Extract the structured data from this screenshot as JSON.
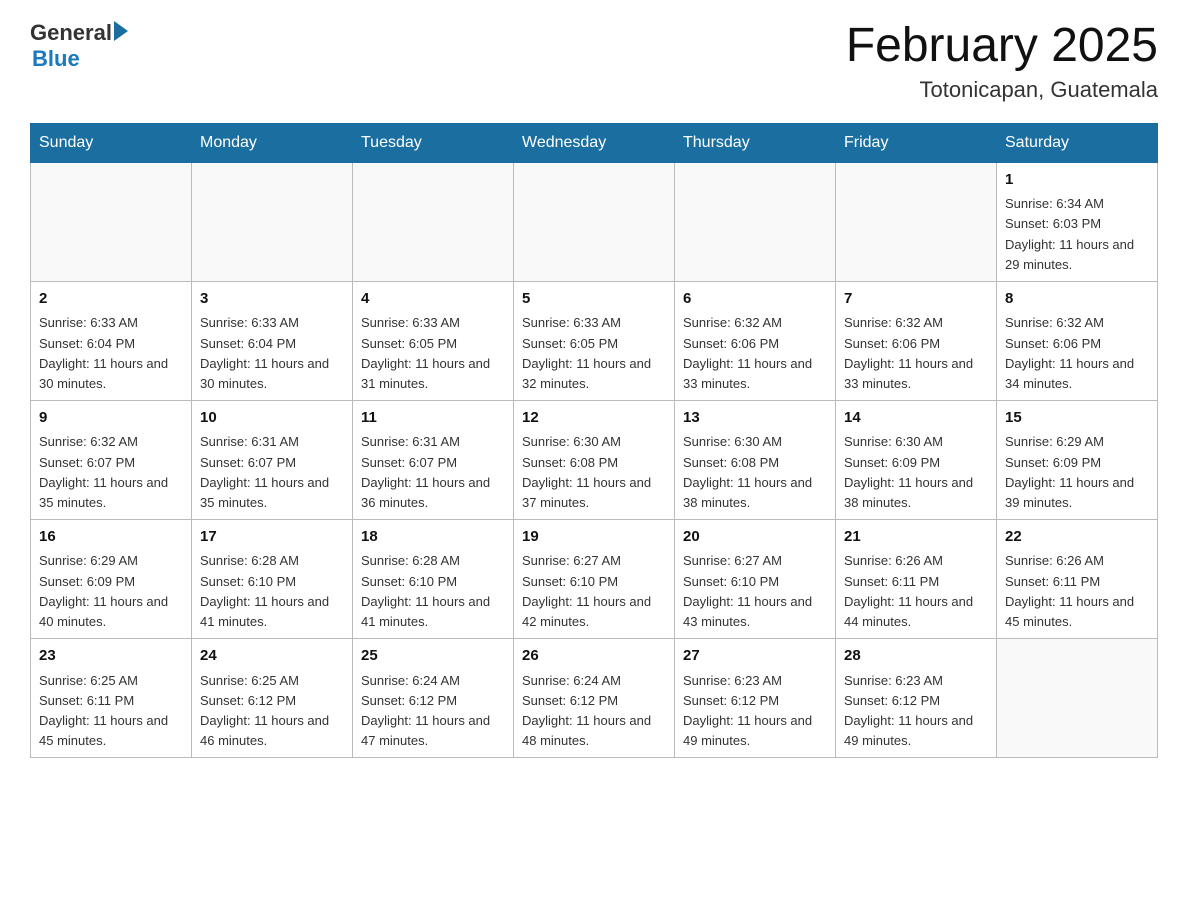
{
  "header": {
    "logo": {
      "line1": "General",
      "arrow": true,
      "line2": "Blue"
    },
    "title": "February 2025",
    "subtitle": "Totonicapan, Guatemala"
  },
  "days_of_week": [
    "Sunday",
    "Monday",
    "Tuesday",
    "Wednesday",
    "Thursday",
    "Friday",
    "Saturday"
  ],
  "weeks": [
    [
      {
        "day": "",
        "info": ""
      },
      {
        "day": "",
        "info": ""
      },
      {
        "day": "",
        "info": ""
      },
      {
        "day": "",
        "info": ""
      },
      {
        "day": "",
        "info": ""
      },
      {
        "day": "",
        "info": ""
      },
      {
        "day": "1",
        "info": "Sunrise: 6:34 AM\nSunset: 6:03 PM\nDaylight: 11 hours and 29 minutes."
      }
    ],
    [
      {
        "day": "2",
        "info": "Sunrise: 6:33 AM\nSunset: 6:04 PM\nDaylight: 11 hours and 30 minutes."
      },
      {
        "day": "3",
        "info": "Sunrise: 6:33 AM\nSunset: 6:04 PM\nDaylight: 11 hours and 30 minutes."
      },
      {
        "day": "4",
        "info": "Sunrise: 6:33 AM\nSunset: 6:05 PM\nDaylight: 11 hours and 31 minutes."
      },
      {
        "day": "5",
        "info": "Sunrise: 6:33 AM\nSunset: 6:05 PM\nDaylight: 11 hours and 32 minutes."
      },
      {
        "day": "6",
        "info": "Sunrise: 6:32 AM\nSunset: 6:06 PM\nDaylight: 11 hours and 33 minutes."
      },
      {
        "day": "7",
        "info": "Sunrise: 6:32 AM\nSunset: 6:06 PM\nDaylight: 11 hours and 33 minutes."
      },
      {
        "day": "8",
        "info": "Sunrise: 6:32 AM\nSunset: 6:06 PM\nDaylight: 11 hours and 34 minutes."
      }
    ],
    [
      {
        "day": "9",
        "info": "Sunrise: 6:32 AM\nSunset: 6:07 PM\nDaylight: 11 hours and 35 minutes."
      },
      {
        "day": "10",
        "info": "Sunrise: 6:31 AM\nSunset: 6:07 PM\nDaylight: 11 hours and 35 minutes."
      },
      {
        "day": "11",
        "info": "Sunrise: 6:31 AM\nSunset: 6:07 PM\nDaylight: 11 hours and 36 minutes."
      },
      {
        "day": "12",
        "info": "Sunrise: 6:30 AM\nSunset: 6:08 PM\nDaylight: 11 hours and 37 minutes."
      },
      {
        "day": "13",
        "info": "Sunrise: 6:30 AM\nSunset: 6:08 PM\nDaylight: 11 hours and 38 minutes."
      },
      {
        "day": "14",
        "info": "Sunrise: 6:30 AM\nSunset: 6:09 PM\nDaylight: 11 hours and 38 minutes."
      },
      {
        "day": "15",
        "info": "Sunrise: 6:29 AM\nSunset: 6:09 PM\nDaylight: 11 hours and 39 minutes."
      }
    ],
    [
      {
        "day": "16",
        "info": "Sunrise: 6:29 AM\nSunset: 6:09 PM\nDaylight: 11 hours and 40 minutes."
      },
      {
        "day": "17",
        "info": "Sunrise: 6:28 AM\nSunset: 6:10 PM\nDaylight: 11 hours and 41 minutes."
      },
      {
        "day": "18",
        "info": "Sunrise: 6:28 AM\nSunset: 6:10 PM\nDaylight: 11 hours and 41 minutes."
      },
      {
        "day": "19",
        "info": "Sunrise: 6:27 AM\nSunset: 6:10 PM\nDaylight: 11 hours and 42 minutes."
      },
      {
        "day": "20",
        "info": "Sunrise: 6:27 AM\nSunset: 6:10 PM\nDaylight: 11 hours and 43 minutes."
      },
      {
        "day": "21",
        "info": "Sunrise: 6:26 AM\nSunset: 6:11 PM\nDaylight: 11 hours and 44 minutes."
      },
      {
        "day": "22",
        "info": "Sunrise: 6:26 AM\nSunset: 6:11 PM\nDaylight: 11 hours and 45 minutes."
      }
    ],
    [
      {
        "day": "23",
        "info": "Sunrise: 6:25 AM\nSunset: 6:11 PM\nDaylight: 11 hours and 45 minutes."
      },
      {
        "day": "24",
        "info": "Sunrise: 6:25 AM\nSunset: 6:12 PM\nDaylight: 11 hours and 46 minutes."
      },
      {
        "day": "25",
        "info": "Sunrise: 6:24 AM\nSunset: 6:12 PM\nDaylight: 11 hours and 47 minutes."
      },
      {
        "day": "26",
        "info": "Sunrise: 6:24 AM\nSunset: 6:12 PM\nDaylight: 11 hours and 48 minutes."
      },
      {
        "day": "27",
        "info": "Sunrise: 6:23 AM\nSunset: 6:12 PM\nDaylight: 11 hours and 49 minutes."
      },
      {
        "day": "28",
        "info": "Sunrise: 6:23 AM\nSunset: 6:12 PM\nDaylight: 11 hours and 49 minutes."
      },
      {
        "day": "",
        "info": ""
      }
    ]
  ]
}
